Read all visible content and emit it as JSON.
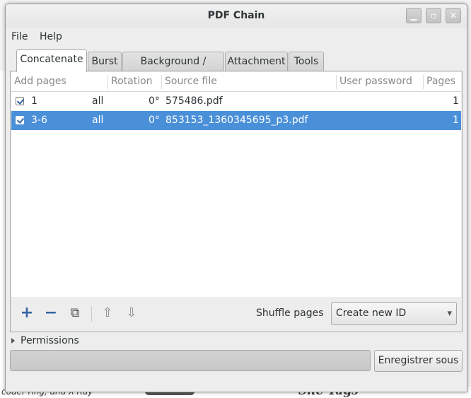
{
  "window": {
    "title": "PDF Chain"
  },
  "menu": {
    "file": "File",
    "help": "Help"
  },
  "tabs": [
    {
      "label": "Concatenate",
      "active": true
    },
    {
      "label": "Burst"
    },
    {
      "label": "Background / Stamp"
    },
    {
      "label": "Attachment"
    },
    {
      "label": "Tools"
    }
  ],
  "table": {
    "columns": [
      "Add pages",
      "Rotation",
      "Source file",
      "User password",
      "Pages"
    ],
    "rows": [
      {
        "checked": true,
        "pages": "1",
        "selection": "all",
        "rotation": "0°",
        "source": "575486.pdf",
        "password": "",
        "count": "1",
        "selected": false
      },
      {
        "checked": true,
        "pages": "3-6",
        "selection": "all",
        "rotation": "0°",
        "source": "853153_1360345695_p3.pdf",
        "password": "",
        "count": "1",
        "selected": true
      }
    ]
  },
  "toolbar": {
    "shuffle_label": "Shuffle pages",
    "id_combo_value": "Create new ID"
  },
  "permissions_label": "Permissions",
  "save_button": "Enregistrer sous",
  "background": {
    "footer_text": "coder-ring, and X-Ray-",
    "footer_title": "She Tags"
  },
  "colors": {
    "selection": "#4a90d9",
    "accent_icon": "#3465a4"
  }
}
